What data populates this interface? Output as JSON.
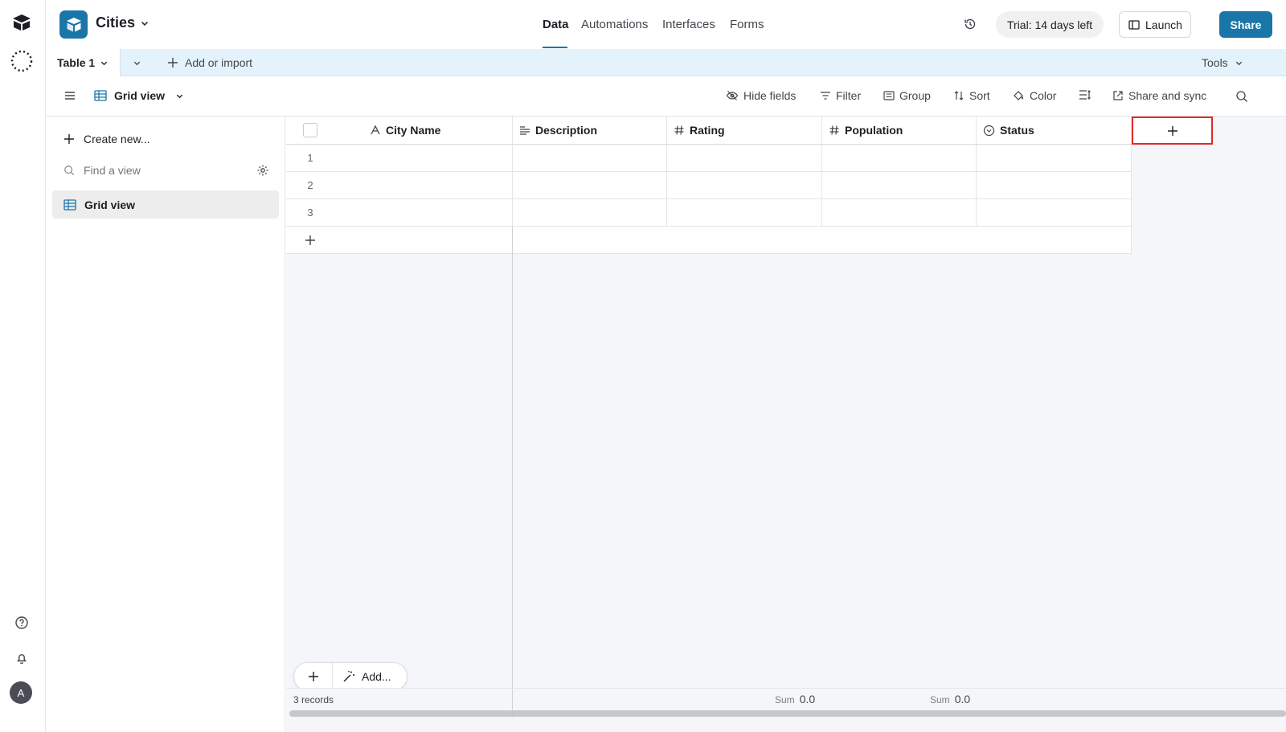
{
  "header": {
    "base_name": "Cities",
    "tabs": [
      "Data",
      "Automations",
      "Interfaces",
      "Forms"
    ],
    "active_tab": "Data",
    "trial": "Trial: 14 days left",
    "launch": "Launch",
    "share": "Share"
  },
  "tablebar": {
    "table_name": "Table 1",
    "add_or_import": "Add or import",
    "tools": "Tools"
  },
  "viewbar": {
    "view_name": "Grid view",
    "hide_fields": "Hide fields",
    "filter": "Filter",
    "group": "Group",
    "sort": "Sort",
    "color": "Color",
    "share_sync": "Share and sync"
  },
  "sidebar": {
    "create_new": "Create new...",
    "find_placeholder": "Find a view",
    "views": [
      "Grid view"
    ]
  },
  "grid": {
    "columns": [
      "City Name",
      "Description",
      "Rating",
      "Population",
      "Status"
    ],
    "rows": [
      "1",
      "2",
      "3"
    ],
    "add_button": "Add...",
    "record_count": "3 records",
    "sum_label": "Sum",
    "rating_sum": "0.0",
    "population_sum": "0.0"
  },
  "rail": {
    "avatar": "A"
  },
  "colors": {
    "accent": "#1a76a8",
    "highlight": "#e02a2a"
  }
}
